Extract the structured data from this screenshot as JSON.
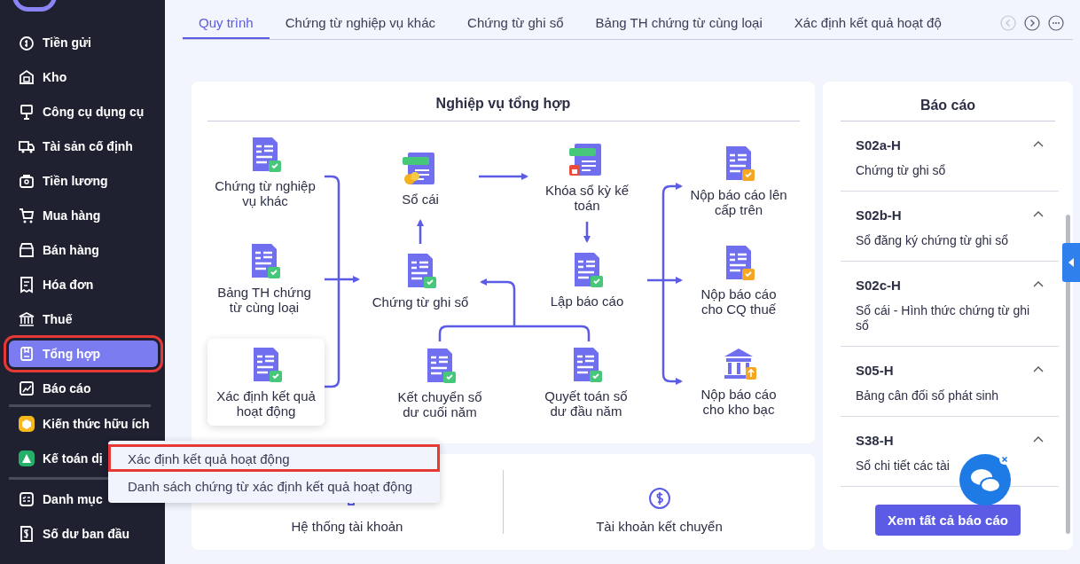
{
  "sidebar": {
    "sections": [
      {
        "items": [
          {
            "label": "Tiền gửi",
            "selected": false,
            "highlighted": false
          },
          {
            "label": "Kho",
            "selected": false,
            "highlighted": false
          },
          {
            "label": "Công cụ dụng cụ",
            "selected": false,
            "highlighted": false
          },
          {
            "label": "Tài sản cố định",
            "selected": false,
            "highlighted": false
          },
          {
            "label": "Tiền lương",
            "selected": false,
            "highlighted": false
          },
          {
            "label": "Mua hàng",
            "selected": false,
            "highlighted": false
          },
          {
            "label": "Bán hàng",
            "selected": false,
            "highlighted": false
          },
          {
            "label": "Hóa đơn",
            "selected": false,
            "highlighted": false
          },
          {
            "label": "Thuế",
            "selected": false,
            "highlighted": false
          },
          {
            "label": "Tổng hợp",
            "selected": true,
            "highlighted": true
          },
          {
            "label": "Báo cáo",
            "selected": false,
            "highlighted": false
          }
        ]
      },
      {
        "items": [
          {
            "label": "Kiến thức hữu ích",
            "selected": false,
            "highlighted": false
          },
          {
            "label": "Kế toán dị",
            "selected": false,
            "highlighted": false
          }
        ]
      },
      {
        "items": [
          {
            "label": "Danh mục",
            "selected": false,
            "highlighted": false
          },
          {
            "label": "Số dư ban đầu",
            "selected": false,
            "highlighted": false
          }
        ]
      }
    ]
  },
  "tabs": [
    {
      "label": "Quy trình",
      "selected": true
    },
    {
      "label": "Chứng từ nghiệp vụ khác",
      "selected": false
    },
    {
      "label": "Chứng từ ghi sổ",
      "selected": false
    },
    {
      "label": "Bảng TH chứng từ cùng loại",
      "selected": false
    },
    {
      "label": "Xác định kết quả hoạt độ",
      "selected": false
    }
  ],
  "workflow": {
    "title": "Nghiệp vụ tổng hợp",
    "nodes": [
      {
        "label": "Chứng từ nghiệp vụ khác",
        "hovered": false
      },
      {
        "label": "Sổ cái",
        "hovered": false
      },
      {
        "label": "Khóa sổ kỳ kế toán",
        "hovered": false
      },
      {
        "label": "Nộp báo cáo lên cấp trên",
        "hovered": false
      },
      {
        "label": "Bảng TH chứng từ cùng loại",
        "hovered": false
      },
      {
        "label": "Chứng từ ghi sổ",
        "hovered": false
      },
      {
        "label": "Lập báo cáo",
        "hovered": false
      },
      {
        "label": "Nộp báo cáo cho CQ thuế",
        "hovered": false
      },
      {
        "label": "Xác định kết quả hoạt động",
        "hovered": true
      },
      {
        "label": "Kết chuyển số dư cuối năm",
        "hovered": false
      },
      {
        "label": "Quyết toán số dư đầu năm",
        "hovered": false
      },
      {
        "label": "Nộp báo cáo cho kho bạc",
        "hovered": false
      }
    ]
  },
  "node_menu": {
    "items": [
      {
        "label": "Xác định kết quả hoạt động",
        "highlighted": true
      },
      {
        "label": "Danh sách chứng từ xác định kết quả hoạt động",
        "highlighted": false
      }
    ]
  },
  "shortcuts": [
    {
      "label": "Hệ thống tài khoản"
    },
    {
      "label": "Tài khoản kết chuyển"
    }
  ],
  "reports": {
    "title": "Báo cáo",
    "items": [
      {
        "code": "S02a-H",
        "description": "Chứng từ ghi sổ",
        "expanded": true
      },
      {
        "code": "S02b-H",
        "description": "Sổ đăng ký chứng từ ghi sổ",
        "expanded": true
      },
      {
        "code": "S02c-H",
        "description": "Sổ cái - Hình thức chứng từ ghi sổ",
        "expanded": true
      },
      {
        "code": "S05-H",
        "description": "Bảng cân đối số phát sinh",
        "expanded": true
      },
      {
        "code": "S38-H",
        "description": "Sổ chi tiết các tài",
        "expanded": true
      }
    ],
    "button": "Xem tất cả báo cáo"
  }
}
